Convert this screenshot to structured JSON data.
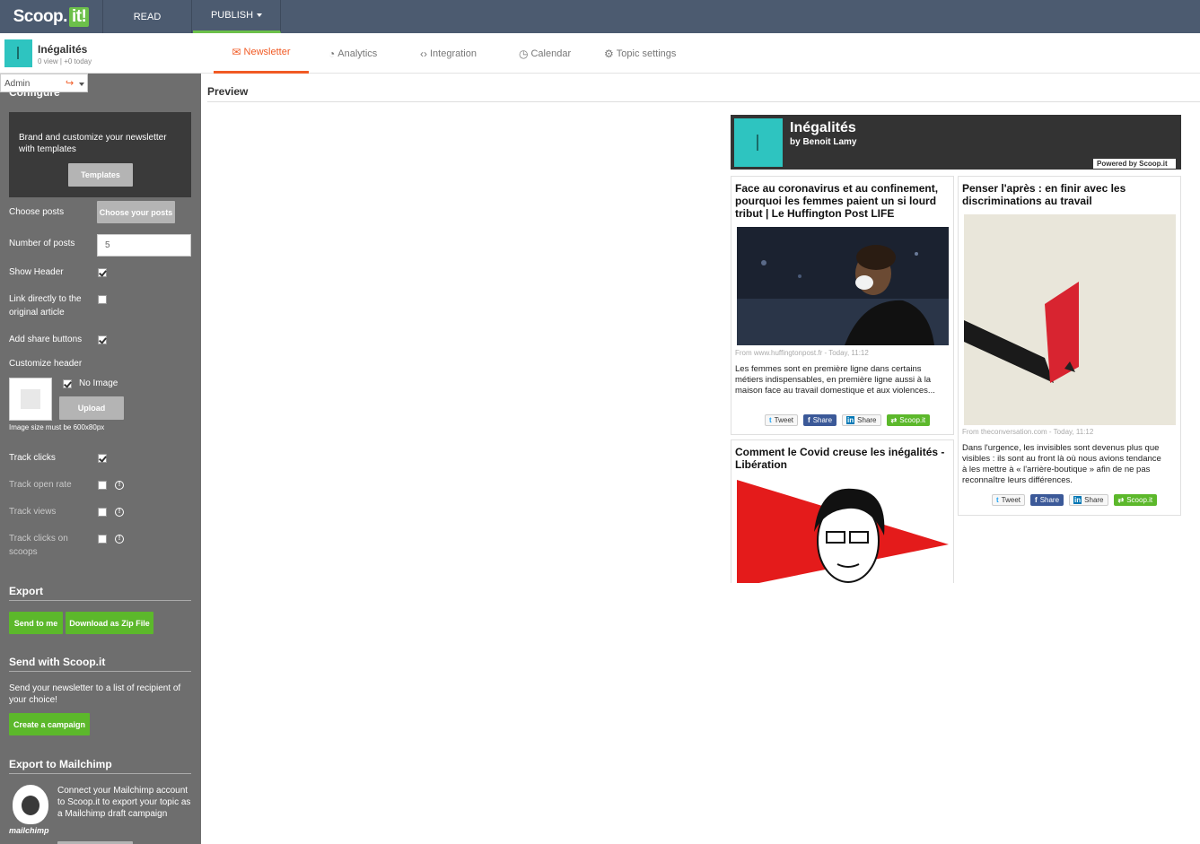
{
  "topbar": {
    "logo_text": "Scoop.",
    "logo_it": "it!",
    "nav_read": "READ",
    "nav_publish": "PUBLISH"
  },
  "topic": {
    "name": "Inégalités",
    "stats": "0 view | +0 today"
  },
  "tabs": [
    {
      "label": "Newsletter",
      "icon": "envelope-icon",
      "active": true
    },
    {
      "label": "Analytics",
      "icon": "pie-chart-icon"
    },
    {
      "label": "Integration",
      "icon": "code-icon"
    },
    {
      "label": "Calendar",
      "icon": "clock-icon"
    },
    {
      "label": "Topic settings",
      "icon": "gears-icon"
    }
  ],
  "sidebar": {
    "admin_label": "Admin",
    "configure_title": "Configure",
    "brand_text": "Brand and customize your newsletter with templates",
    "templates_button": "Templates",
    "choose_posts_label": "Choose posts",
    "choose_posts_button": "Choose your posts",
    "number_posts_label": "Number of posts",
    "number_posts_value": "5",
    "show_header_label": "Show Header",
    "link_direct_label": "Link directly to the original article",
    "add_share_label": "Add share buttons",
    "customize_header_label": "Customize header",
    "no_image_label": "No Image",
    "upload_button": "Upload",
    "image_size_note": "Image size must be 600x80px",
    "track_clicks_label": "Track clicks",
    "track_open_label": "Track open rate",
    "track_views_label": "Track views",
    "track_clicks_scoops_label": "Track clicks on scoops",
    "export_title": "Export",
    "send_to_me_button": "Send to me",
    "download_zip_button": "Download as Zip File",
    "send_scoop_title": "Send with Scoop.it",
    "send_scoop_text": "Send your newsletter to a list of recipient of your choice!",
    "create_campaign_button": "Create a campaign",
    "mailchimp_title": "Export to Mailchimp",
    "mailchimp_text": "Connect your Mailchimp account to Scoop.it to export your topic as a Mailchimp draft campaign",
    "mailchimp_logo_word": "mailchimp"
  },
  "preview": {
    "title": "Preview",
    "newsletter": {
      "title": "Inégalités",
      "by": "by Benoit Lamy",
      "powered": "Powered by Scoop.it",
      "posts": [
        {
          "title": "Face au coronavirus et au confinement, pourquoi les femmes paient un si lourd tribut | Le Huffington Post LIFE",
          "from": "From www.huffingtonpost.fr - Today, 11:12",
          "desc": "Les femmes sont en première ligne dans certains métiers indispensables, en première ligne aussi à la maison face au travail domestique et aux violences..."
        },
        {
          "title": "Penser l'après : en finir avec les discriminations au travail",
          "from": "From theconversation.com - Today, 11:12",
          "desc": "Dans l'urgence, les invisibles sont devenus plus que visibles : ils sont au front là où nous avions tendance à les mettre à « l'arrière-boutique » afin de ne pas reconnaître leurs différences."
        },
        {
          "title": "Comment le Covid creuse les inégalités - Libération"
        }
      ],
      "share": {
        "tweet": "Tweet",
        "share_fb": "Share",
        "share_li": "Share",
        "scoopit": "Scoop.it"
      }
    }
  },
  "colors": {
    "accent": "#f15a24",
    "green": "#5cb82b",
    "topbar": "#4c5b70",
    "sidebar": "#6e6e6e"
  }
}
